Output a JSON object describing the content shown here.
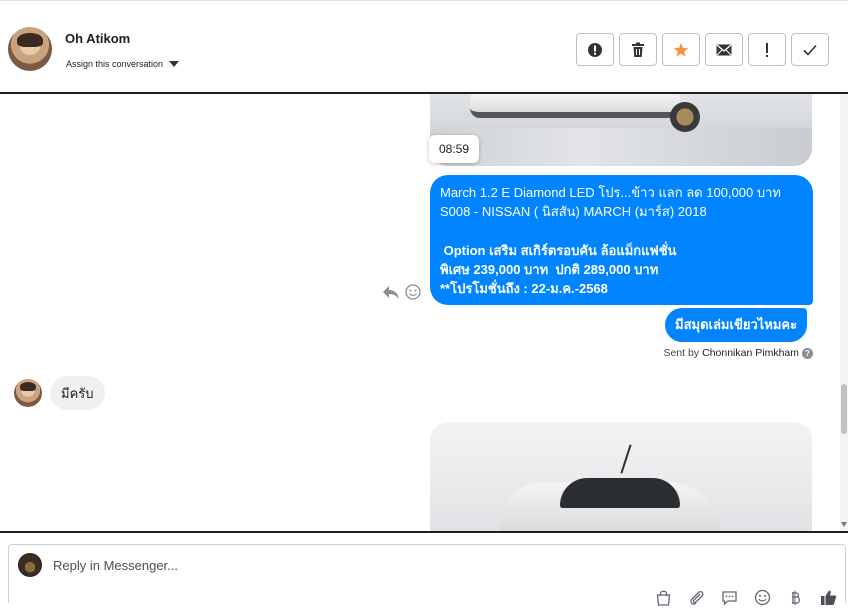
{
  "header": {
    "contact_name": "Oh Atikom",
    "assign_label": "Assign this conversation"
  },
  "thread": {
    "timestamp_tip": "08:59",
    "outgoing_message_lines": [
      "March 1.2 E Diamond LED โปร...ข้าว แลก ลด 100,000 บาท",
      "S008 - NISSAN ( นิสสัน) MARCH (มาร์ส) 2018",
      "",
      " Option เสริม สเกิร์ตรอบคัน ล้อแม็กแฟชั่น",
      "พิเศษ 239,000 บาท  ปกติ 289,000 บาท",
      "**โปรโมชั่นถึง : 22-ม.ค.-2568"
    ],
    "outgoing_followup": "มีสมุดเล่มเขียวไหมคะ",
    "sent_by_prefix": "Sent by",
    "sent_by_name": "Chonnikan Pimkham",
    "incoming_reply": "มีครับ"
  },
  "composer": {
    "placeholder": "Reply in Messenger..."
  },
  "colors": {
    "outgoing_bubble": "#0084ff",
    "incoming_bubble": "#f0f0f0",
    "star": "#f7923a"
  }
}
